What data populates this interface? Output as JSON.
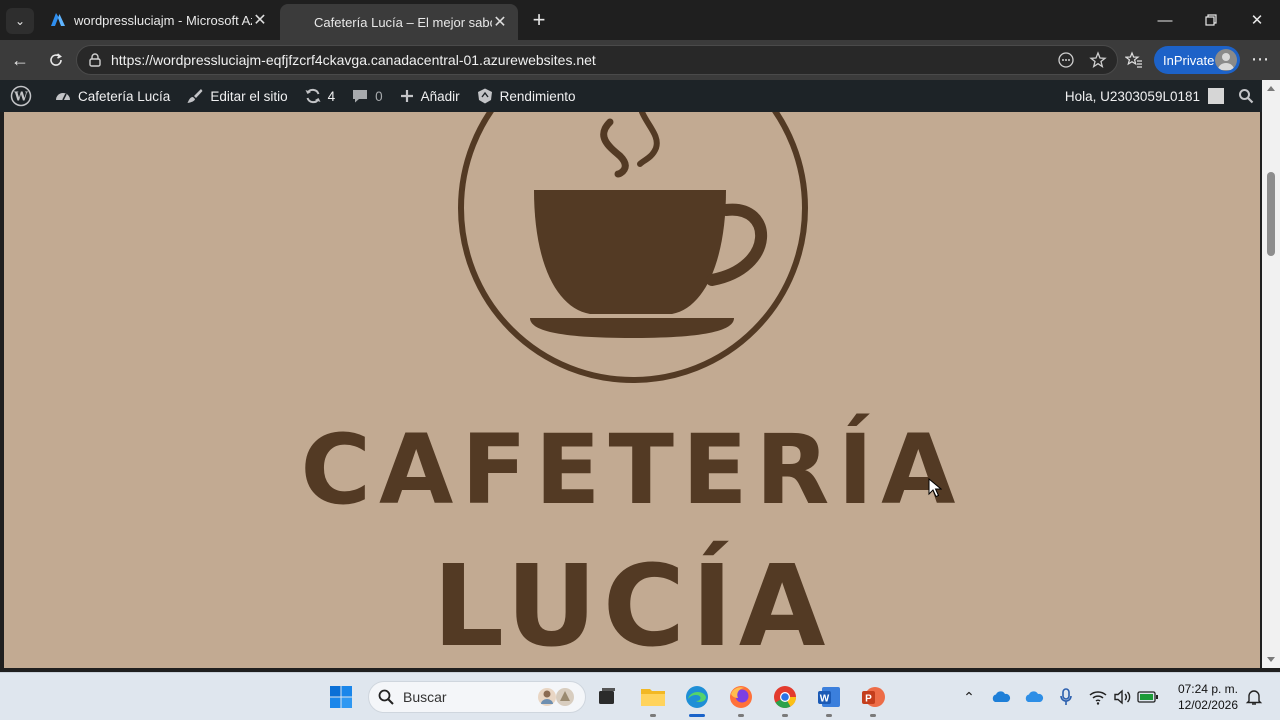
{
  "browser": {
    "tabs": [
      {
        "title": "wordpressluciajm - Microsoft Azure",
        "active": false
      },
      {
        "title": "Cafetería Lucía – El mejor sabor para tu día",
        "active": true
      }
    ],
    "url": "https://wordpressluciajm-eqfjfzcrf4ckavga.canadacentral-01.azurewebsites.net",
    "inprivate_label": "InPrivate"
  },
  "wp_admin_bar": {
    "site_name": "Cafetería Lucía",
    "edit_site": "Editar el sitio",
    "updates_count": "4",
    "comments_count": "0",
    "add_new": "Añadir",
    "performance": "Rendimiento",
    "greeting": "Hola, U2303059L0181"
  },
  "page": {
    "logo_line1": "CAFETERÍA",
    "logo_line2": "LUCÍA",
    "colors": {
      "background": "#c2aa92",
      "brand": "#533a24"
    }
  },
  "taskbar": {
    "search_placeholder": "Buscar",
    "time": "07:24 p. m.",
    "date": "12/02/2026"
  }
}
